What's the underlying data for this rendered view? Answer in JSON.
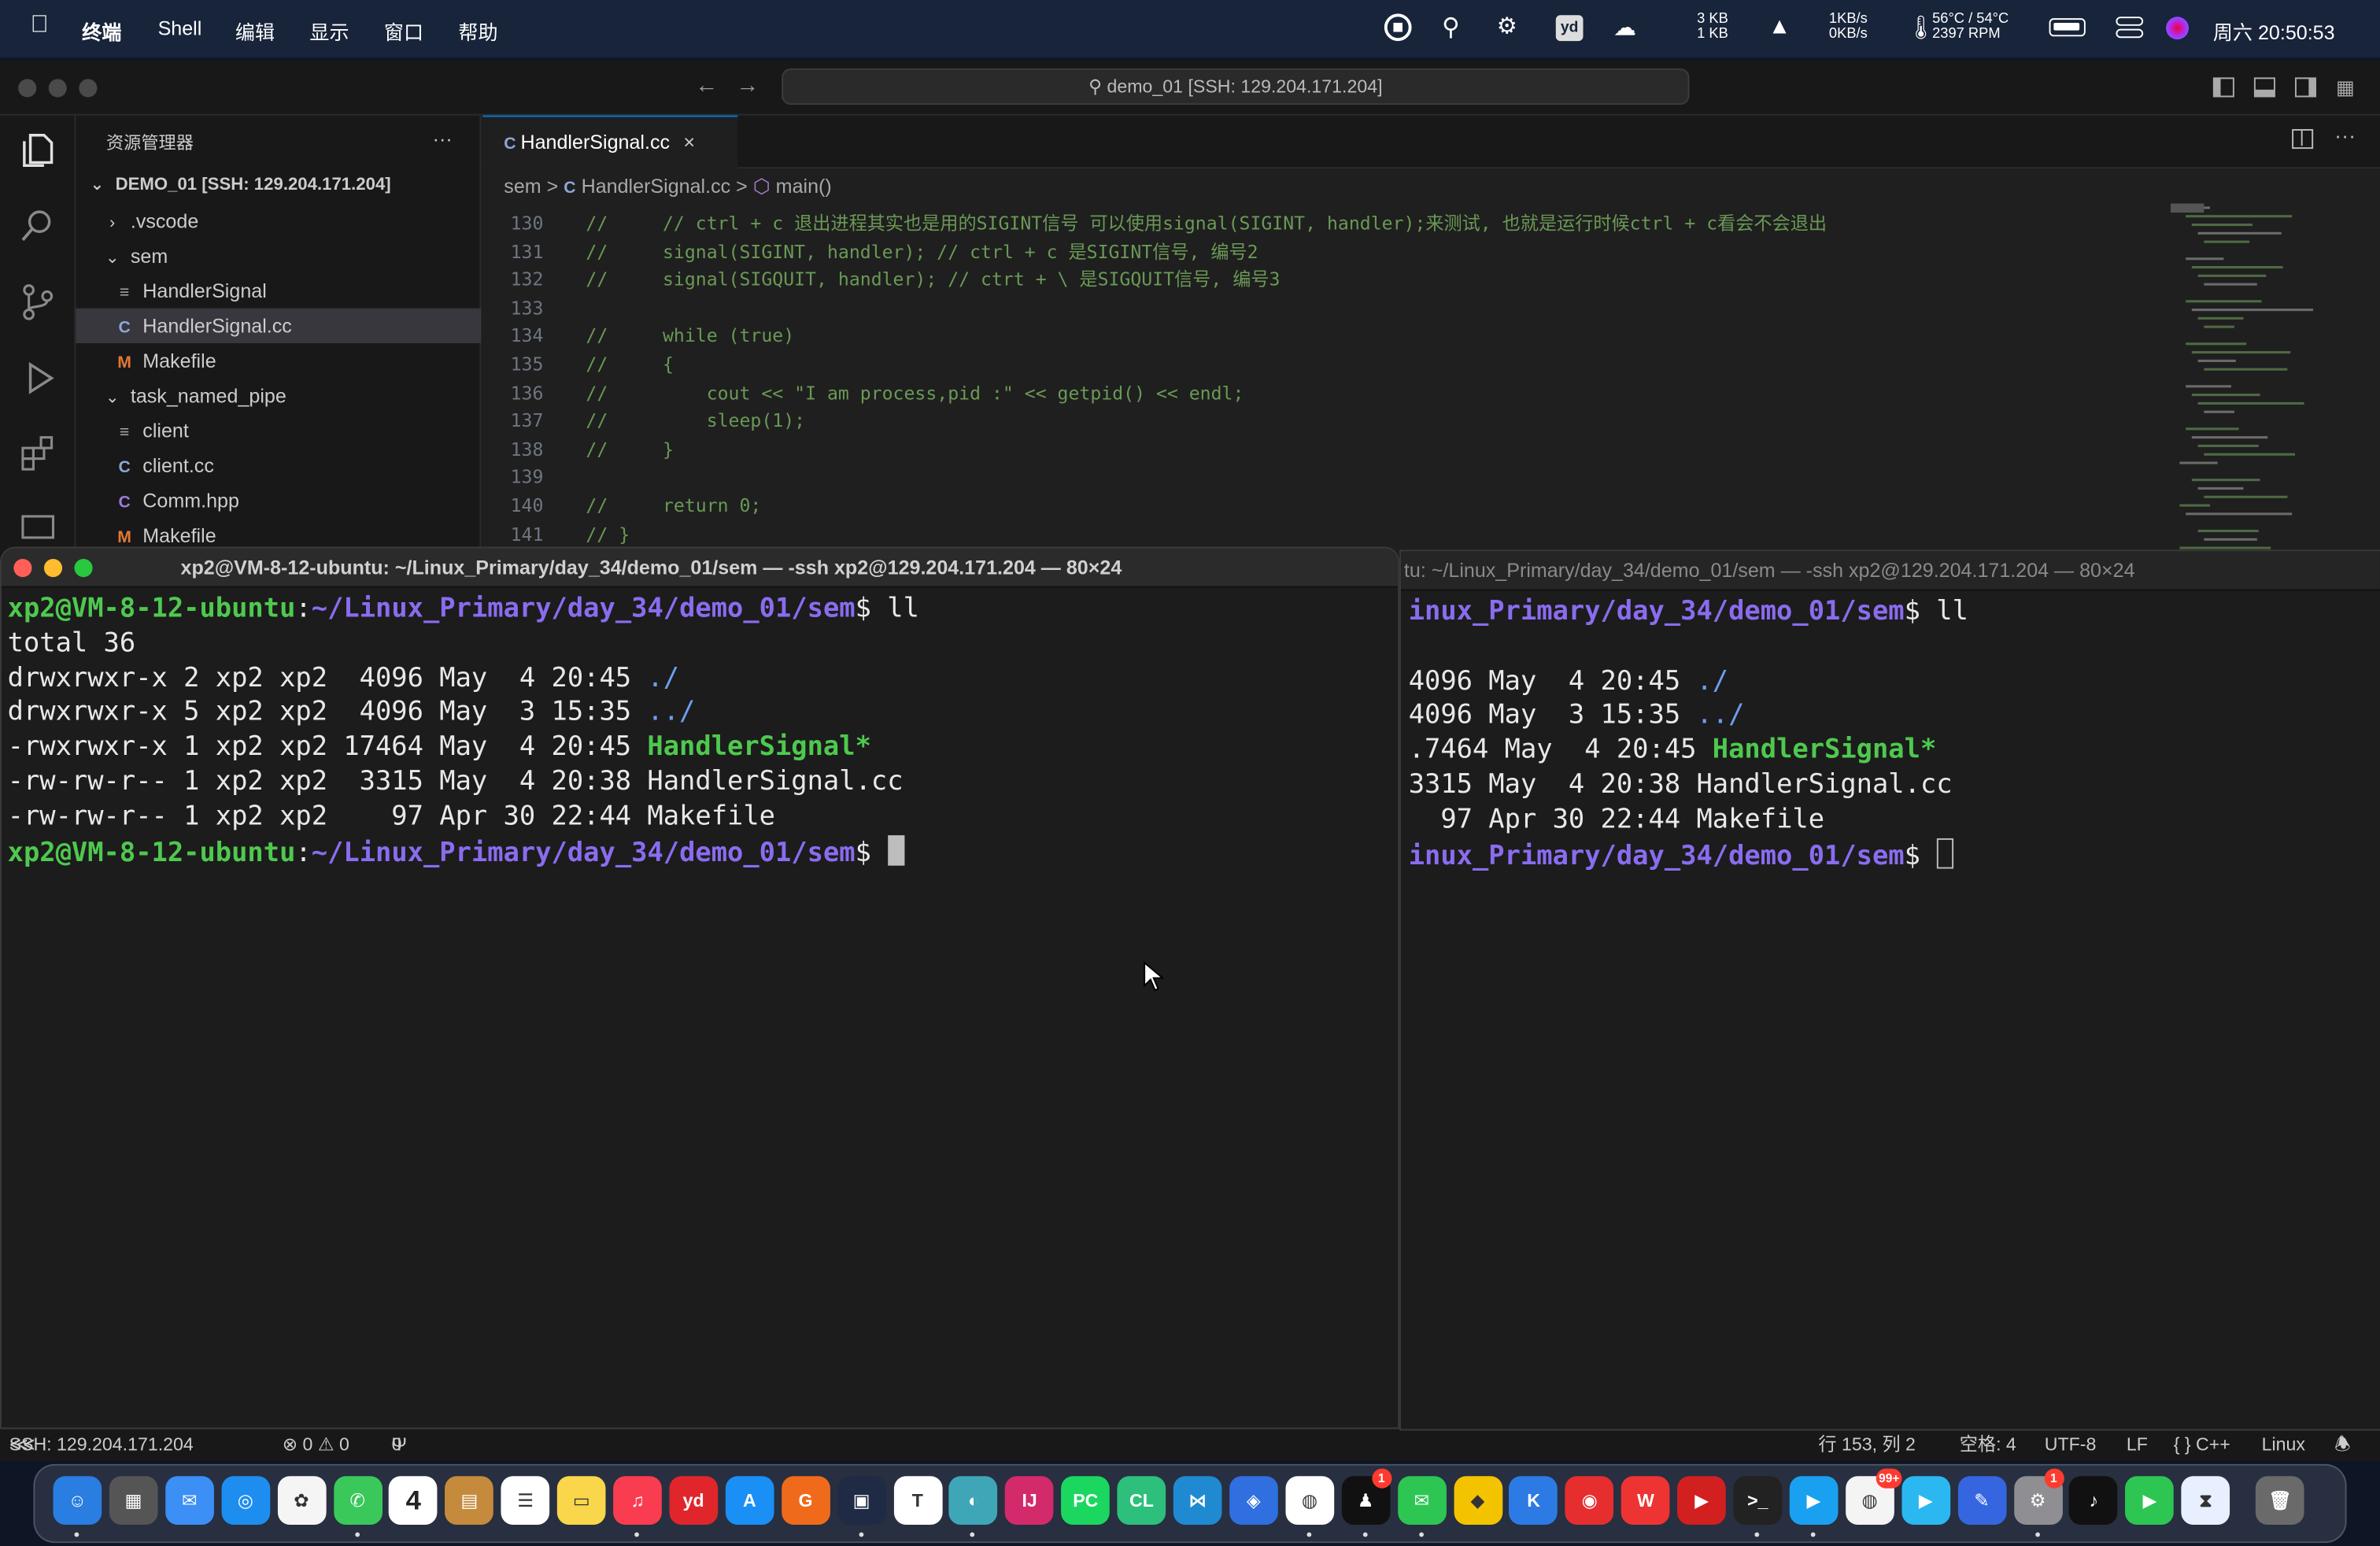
{
  "menubar": {
    "app_name": "终端",
    "menus": [
      "Shell",
      "编辑",
      "显示",
      "窗口",
      "帮助"
    ],
    "net_up": "3 KB",
    "net_down": "1 KB",
    "rate_up": "1KB/s",
    "rate_down": "0KB/s",
    "temps": "56°C / 54°C",
    "fan": "2397 RPM",
    "clock": "周六 20:50:53"
  },
  "vscode": {
    "command_center": "demo_01 [SSH: 129.204.171.204]",
    "explorer_title": "资源管理器",
    "explorer_more": "···",
    "workspace": "DEMO_01 [SSH: 129.204.171.204]",
    "tree": [
      {
        "label": ".vscode",
        "icon": ">"
      },
      {
        "label": "sem",
        "icon": "v"
      },
      {
        "label": "HandlerSignal",
        "icon": "≡"
      },
      {
        "label": "HandlerSignal.cc",
        "icon": "C"
      },
      {
        "label": "Makefile",
        "icon": "M"
      },
      {
        "label": "task_named_pipe",
        "icon": "v"
      },
      {
        "label": "client",
        "icon": "≡"
      },
      {
        "label": "client.cc",
        "icon": "C"
      },
      {
        "label": "Comm.hpp",
        "icon": "C"
      },
      {
        "label": "Makefile",
        "icon": "M"
      }
    ],
    "tab": "HandlerSignal.cc",
    "tab_close": "×",
    "breadcrumb": {
      "folder": "sem",
      "sep": ">",
      "file": "HandlerSignal.cc",
      "symbol": "main()"
    },
    "code": [
      {
        "n": "130",
        "t": "//     // ctrl + c 退出进程其实也是用的SIGINT信号 可以使用signal(SIGINT, handler);来测试, 也就是运行时候ctrl + c看会不会退出"
      },
      {
        "n": "131",
        "t": "//     signal(SIGINT, handler); // ctrl + c 是SIGINT信号, 编号2"
      },
      {
        "n": "132",
        "t": "//     signal(SIGQUIT, handler); // ctrt + \\ 是SIGQUIT信号, 编号3"
      },
      {
        "n": "133",
        "t": ""
      },
      {
        "n": "134",
        "t": "//     while (true)"
      },
      {
        "n": "135",
        "t": "//     {"
      },
      {
        "n": "136",
        "t": "//         cout << \"I am process,pid :\" << getpid() << endl;"
      },
      {
        "n": "137",
        "t": "//         sleep(1);"
      },
      {
        "n": "138",
        "t": "//     }"
      },
      {
        "n": "139",
        "t": ""
      },
      {
        "n": "140",
        "t": "//     return 0;"
      },
      {
        "n": "141",
        "t": "// }"
      }
    ],
    "status": {
      "remote": "SSH: 129.204.171.204",
      "problems": "⊗ 0 ⚠ 0",
      "ports": "0",
      "cursor": "行 153, 列 2",
      "spaces": "空格: 4",
      "encoding": "UTF-8",
      "eol": "LF",
      "language": "{ } C++",
      "os": "Linux"
    }
  },
  "terminal_front": {
    "title": "xp2@VM-8-12-ubuntu: ~/Linux_Primary/day_34/demo_01/sem — -ssh xp2@129.204.171.204 — 80×24",
    "user_host": "xp2@VM-8-12-ubuntu",
    "path": "~/Linux_Primary/day_34/demo_01/sem",
    "command": "ll",
    "total": "total 36",
    "files": [
      {
        "meta": "drwxrwxr-x 2 xp2 xp2  4096 May  4 20:45 ",
        "name": "./"
      },
      {
        "meta": "drwxrwxr-x 5 xp2 xp2  4096 May  3 15:35 ",
        "name": "../"
      },
      {
        "meta": "-rwxrwxr-x 1 xp2 xp2 17464 May  4 20:45 ",
        "name": "HandlerSignal*"
      },
      {
        "meta": "-rw-rw-r-- 1 xp2 xp2  3315 May  4 20:38 ",
        "name": "HandlerSignal.cc"
      },
      {
        "meta": "-rw-rw-r-- 1 xp2 xp2    97 Apr 30 22:44 ",
        "name": "Makefile"
      }
    ]
  },
  "terminal_back": {
    "title": "tu: ~/Linux_Primary/day_34/demo_01/sem — -ssh xp2@129.204.171.204 — 80×24",
    "prompt_tail": "inux_Primary/day_34/demo_01/sem",
    "command": "ll",
    "files": [
      {
        "meta": "4096 May  4 20:45 ",
        "name": "./"
      },
      {
        "meta": "4096 May  3 15:35 ",
        "name": "../"
      },
      {
        "meta": ".7464 May  4 20:45 ",
        "name": "HandlerSignal*"
      },
      {
        "meta": "3315 May  4 20:38 ",
        "name": "HandlerSignal.cc"
      },
      {
        "meta": "  97 Apr 30 22:44 ",
        "name": "Makefile"
      }
    ]
  },
  "dock": {
    "calendar_day": "4",
    "badge_qq": "1",
    "badge_chrome2": "99+",
    "badge_settings": "1",
    "apps": [
      "Finder",
      "Launchpad",
      "Mail",
      "Safari",
      "Photos",
      "Messages",
      "Calendar",
      "Notes-app",
      "Reminders",
      "Notes",
      "Music",
      "Youdao",
      "App Store",
      "Toolbox",
      "Screens",
      "Typora",
      "Remote",
      "IntelliJ IDEA",
      "PyCharm",
      "CLion",
      "VS Code",
      "Lark",
      "Chrome",
      "QQ",
      "WeChat",
      "Maps",
      "Kuake",
      "NetEase Music",
      "WPS",
      "PDF",
      "Terminal",
      "Infuse",
      "Chrome Dev",
      "Arrow",
      "Pencil",
      "System Settings",
      "TikTok",
      "FaceTime",
      "Dict",
      "Trash"
    ]
  },
  "colors": {
    "prompt_green": "#4ec94e",
    "prompt_purple": "#8a6cf0",
    "dir_blue": "#6c9fee",
    "comment_green": "#6a9955",
    "accent_blue": "#0078d4"
  }
}
